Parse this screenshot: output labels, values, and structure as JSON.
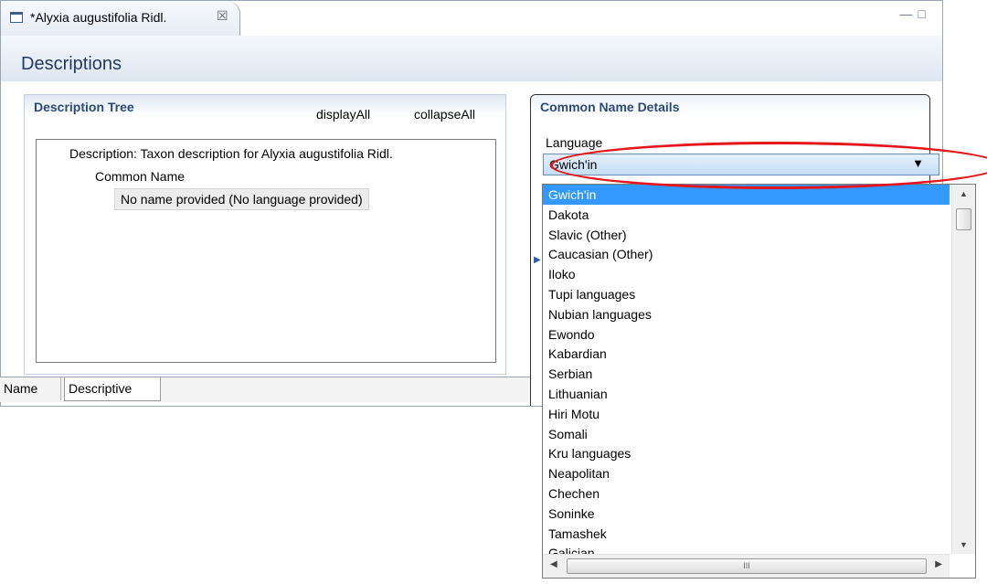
{
  "editor_tab": {
    "title": "*Alyxia augustifolia Ridl.",
    "close_glyph": "☒",
    "window_controls": "—□"
  },
  "page_title": "Descriptions",
  "description_tree": {
    "title": "Description Tree",
    "display_all": "displayAll",
    "collapse_all": "collapseAll",
    "nodes": {
      "description": "Description: Taxon description for Alyxia augustifolia Ridl.",
      "common_name": "Common Name",
      "no_name": "No name provided (No language provided)"
    }
  },
  "common_name_details": {
    "title": "Common Name Details",
    "language_label": "Language",
    "selected_language": "Gwich'in"
  },
  "language_options": [
    "Gwich'in",
    "Dakota",
    "Slavic (Other)",
    "Caucasian (Other)",
    "Iloko",
    "Tupi languages",
    "Nubian languages",
    "Ewondo",
    "Kabardian",
    "Serbian",
    "Lithuanian",
    "Hiri Motu",
    "Somali",
    "Kru languages",
    "Neapolitan",
    "Chechen",
    "Soninke",
    "Tamashek",
    "Galician"
  ],
  "bottom_tabs": [
    "Name",
    "Descriptive"
  ],
  "scrollbar": {
    "up": "▲",
    "down": "▼",
    "left": "◀",
    "right": "▶",
    "grip": "III"
  },
  "colors": {
    "selection": "#3399ff",
    "annotation": "#e4161b",
    "header_text": "#243a60"
  }
}
